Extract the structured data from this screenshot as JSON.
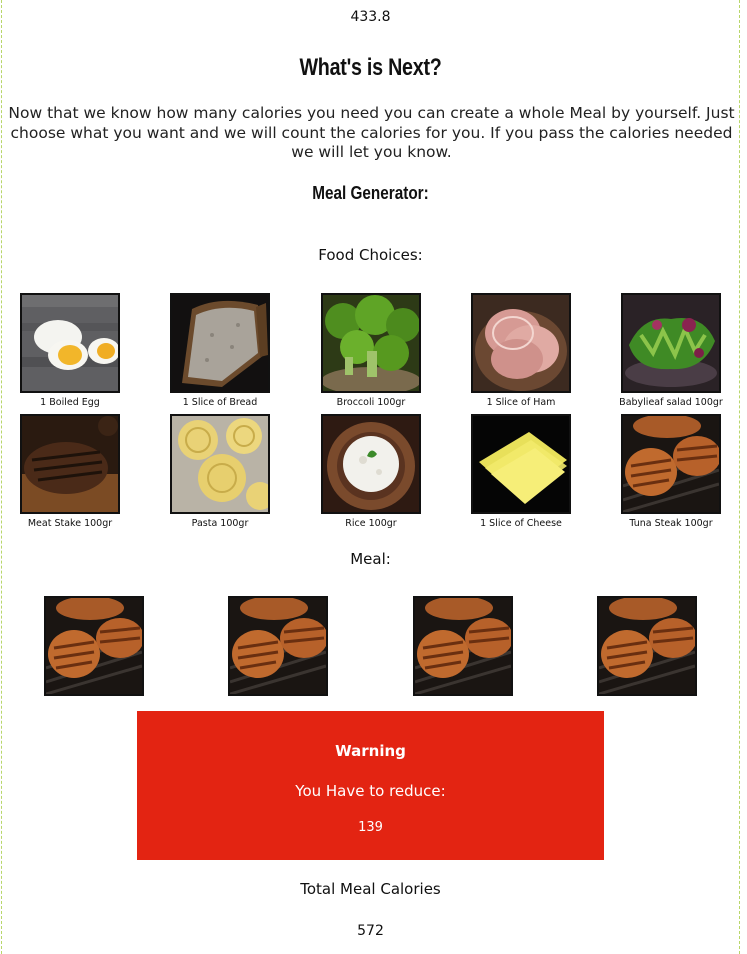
{
  "calories_needed": "433.8",
  "heading": "What's is Next?",
  "intro": "Now that we know how many calories you need you can create a whole Meal by yourself. Just choose what you want and we will count the calories for you. If you pass the calories needed we will let you know.",
  "generator_title": "Meal Generator:",
  "choices_title": "Food Choices:",
  "foods": [
    {
      "label": "1 Boiled Egg",
      "icon": "boiled-egg-image"
    },
    {
      "label": "1 Slice of Bread",
      "icon": "bread-slice-image"
    },
    {
      "label": "Broccoli 100gr",
      "icon": "broccoli-image"
    },
    {
      "label": "1 Slice of Ham",
      "icon": "ham-image"
    },
    {
      "label": "Babylieaf salad 100gr",
      "icon": "salad-image"
    },
    {
      "label": "Meat Stake 100gr",
      "icon": "meat-steak-image"
    },
    {
      "label": "Pasta 100gr",
      "icon": "pasta-image"
    },
    {
      "label": "Rice 100gr",
      "icon": "rice-image"
    },
    {
      "label": "1 Slice of Cheese",
      "icon": "cheese-image"
    },
    {
      "label": "Tuna Steak 100gr",
      "icon": "tuna-steak-image"
    }
  ],
  "meal_title": "Meal:",
  "meal_items": [
    "tuna-steak-image",
    "tuna-steak-image",
    "tuna-steak-image",
    "tuna-steak-image"
  ],
  "warning": {
    "title": "Warning",
    "message": "You Have to reduce:",
    "value": "139",
    "color": "#e32412"
  },
  "total_title": "Total Meal Calories",
  "total_value": "572"
}
